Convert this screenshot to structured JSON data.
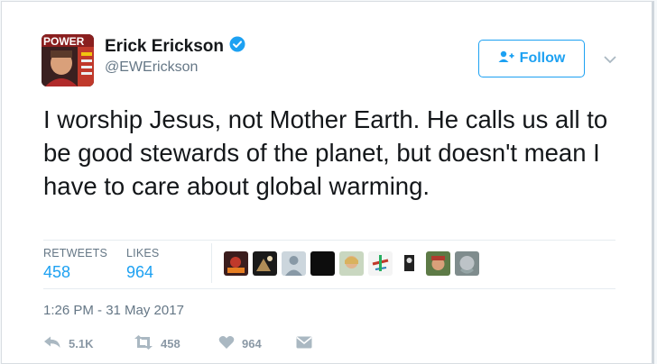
{
  "author": {
    "name": "Erick Erickson",
    "handle": "@EWErickson",
    "avatar_label": "POWER"
  },
  "follow_button": {
    "label": "Follow"
  },
  "tweet": {
    "text": "I worship Jesus, not Mother Earth. He calls us all to be good stewards of the planet, but doesn't mean I have to care about global warming.",
    "timestamp": "1:26 PM - 31 May 2017"
  },
  "stats": {
    "retweets_label": "RETWEETS",
    "retweets_value": "458",
    "likes_label": "LIKES",
    "likes_value": "964"
  },
  "actions": {
    "reply_count": "5.1K",
    "retweet_count": "458",
    "like_count": "964"
  },
  "colors": {
    "accent": "#1da1f2",
    "muted": "#657786",
    "verified": "#1da1f2"
  }
}
